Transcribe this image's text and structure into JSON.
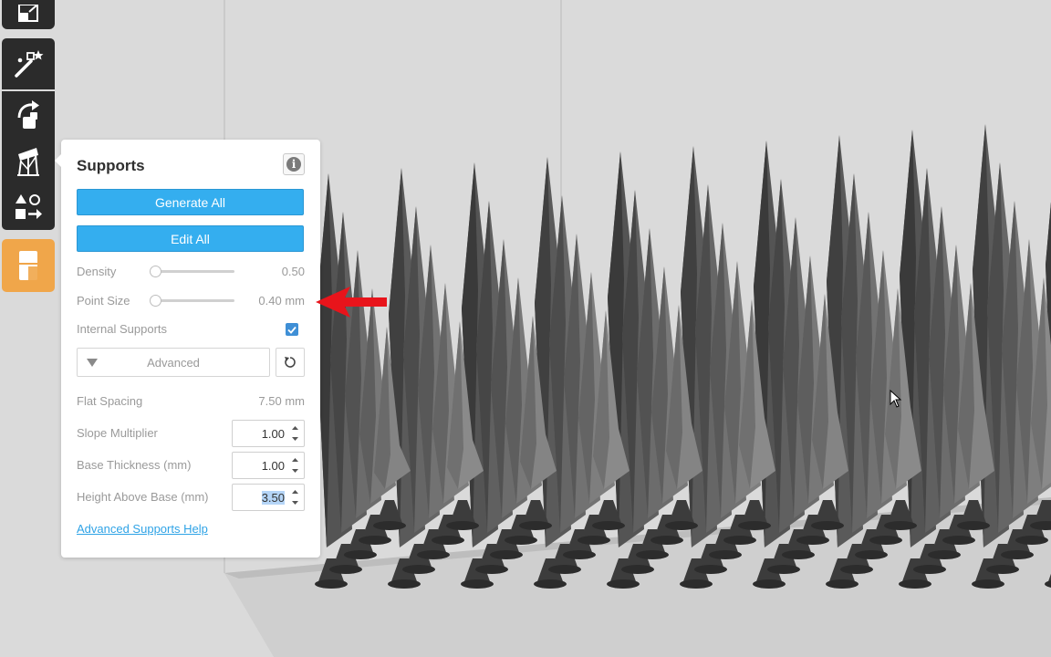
{
  "panel": {
    "title": "Supports",
    "generate_all_label": "Generate All",
    "edit_all_label": "Edit All",
    "density": {
      "label": "Density",
      "value": "0.50",
      "slider_fraction": 0.0
    },
    "point_size": {
      "label": "Point Size",
      "value": "0.40 mm",
      "slider_fraction": 0.0
    },
    "internal_supports": {
      "label": "Internal Supports",
      "checked": true
    },
    "advanced_label": "Advanced",
    "flat_spacing": {
      "label": "Flat Spacing",
      "value": "7.50 mm"
    },
    "slope_multiplier": {
      "label": "Slope Multiplier",
      "value": "1.00"
    },
    "base_thickness": {
      "label": "Base Thickness (mm)",
      "value": "1.00"
    },
    "height_above_base": {
      "label": "Height Above Base (mm)",
      "value": "3.50"
    },
    "help_link": "Advanced Supports Help"
  },
  "toolbar": {
    "tools": [
      "layout-icon",
      "magic-wand-icon",
      "rotate-icon",
      "supports-icon",
      "arrange-icon",
      "print-layer-icon"
    ],
    "active_tool": "print-layer-icon"
  },
  "colors": {
    "accent_blue": "#34aeef",
    "active_orange": "#f0a64a",
    "toolbar_dark": "#2b2b2b",
    "annotation_red": "#e8141b",
    "viewport_bg": "#dadada"
  }
}
